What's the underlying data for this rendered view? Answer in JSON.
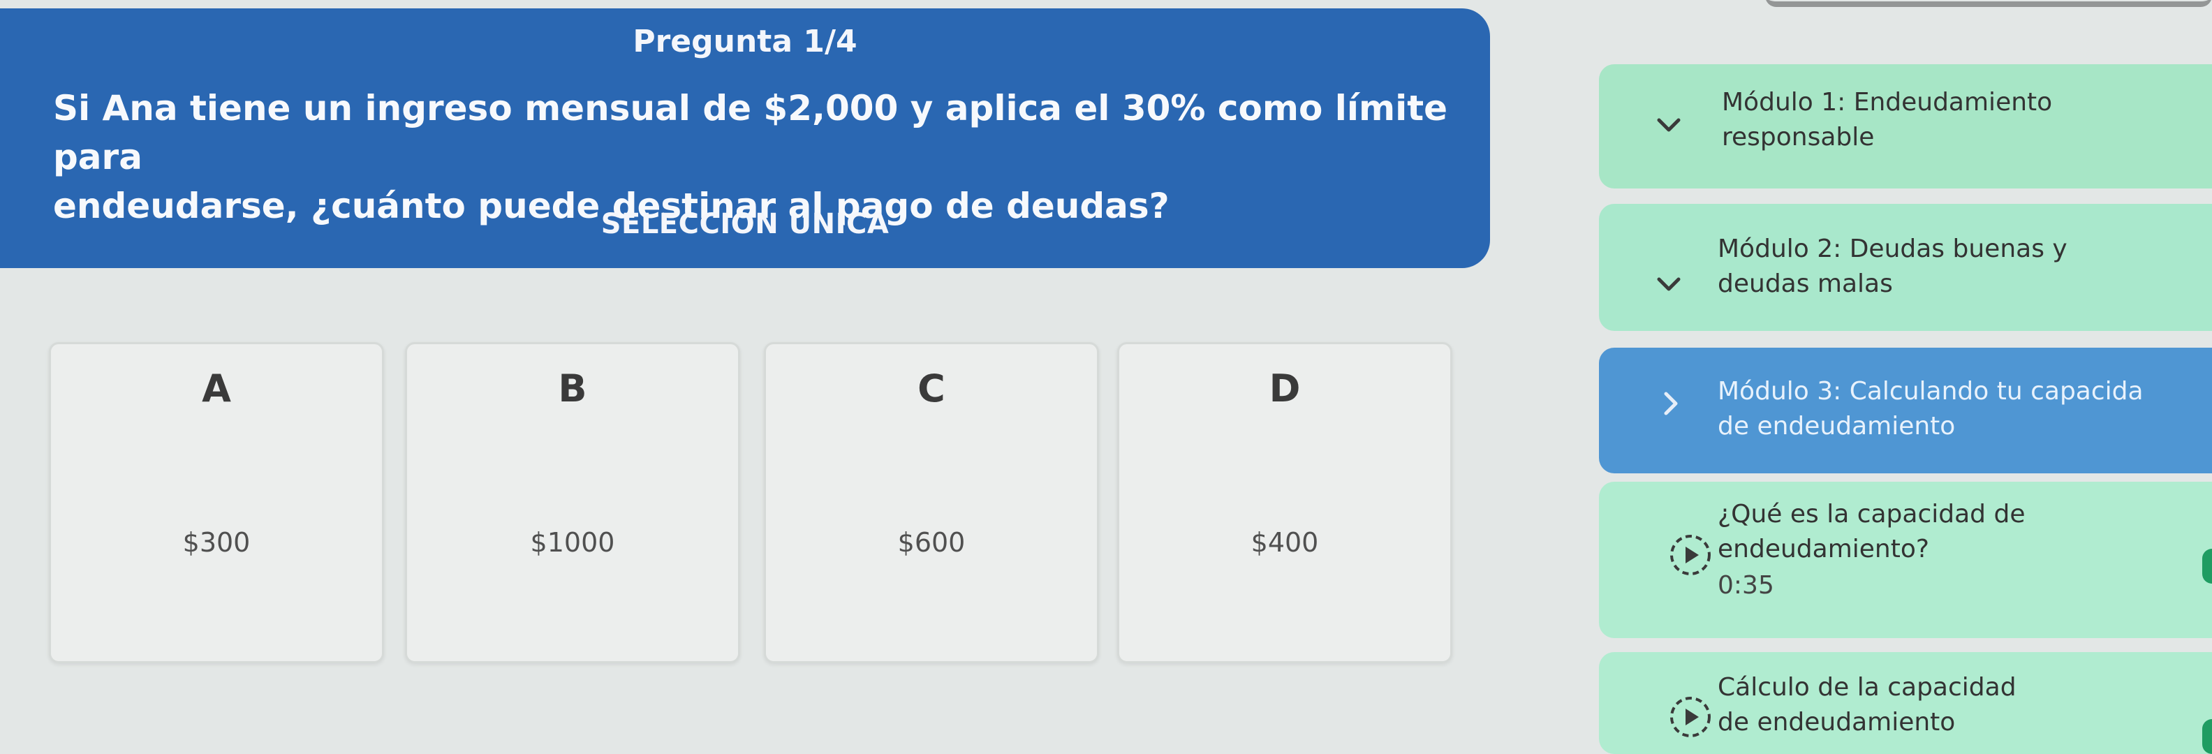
{
  "question": {
    "number_label": "Pregunta 1/4",
    "text_line1": "Si Ana tiene un ingreso mensual de $2,000 y aplica el 30% como límite para",
    "text_line2": "endeudarse, ¿cuánto puede destinar al pago de deudas?",
    "type_label": "SELECCION UNICA"
  },
  "options": [
    {
      "letter": "A",
      "value": "$300"
    },
    {
      "letter": "B",
      "value": "$1000"
    },
    {
      "letter": "C",
      "value": "$600"
    },
    {
      "letter": "D",
      "value": "$400"
    }
  ],
  "sidebar": {
    "modules": [
      {
        "title_line1": "Módulo 1: Endeudamiento",
        "title_line2": "responsable",
        "state": "expanded",
        "chevron_icon": "chevron-down-icon"
      },
      {
        "title_line1": "Módulo 2: Deudas buenas y",
        "title_line2": "deudas malas",
        "state": "expanded",
        "chevron_icon": "chevron-down-icon"
      },
      {
        "title_line1": "Módulo 3: Calculando tu capacida",
        "title_line2": "de endeudamiento",
        "state": "active",
        "chevron_icon": "chevron-right-icon"
      }
    ],
    "lessons": [
      {
        "title_line1": "¿Qué es la capacidad de",
        "title_line2": "endeudamiento?",
        "duration": "0:35",
        "icon": "play-circle-icon"
      },
      {
        "title_line1": "Cálculo de la capacidad",
        "title_line2": "de endeudamiento",
        "icon": "play-circle-icon"
      }
    ]
  },
  "colors": {
    "question_bg": "#2a67b2",
    "module_bg": "#a7e6c6",
    "module_active_bg": "#4f96d3",
    "lesson_bg": "#b0ecd0",
    "edge_indicator": "#1f9c62",
    "page_bg": "#e3e7e6"
  }
}
